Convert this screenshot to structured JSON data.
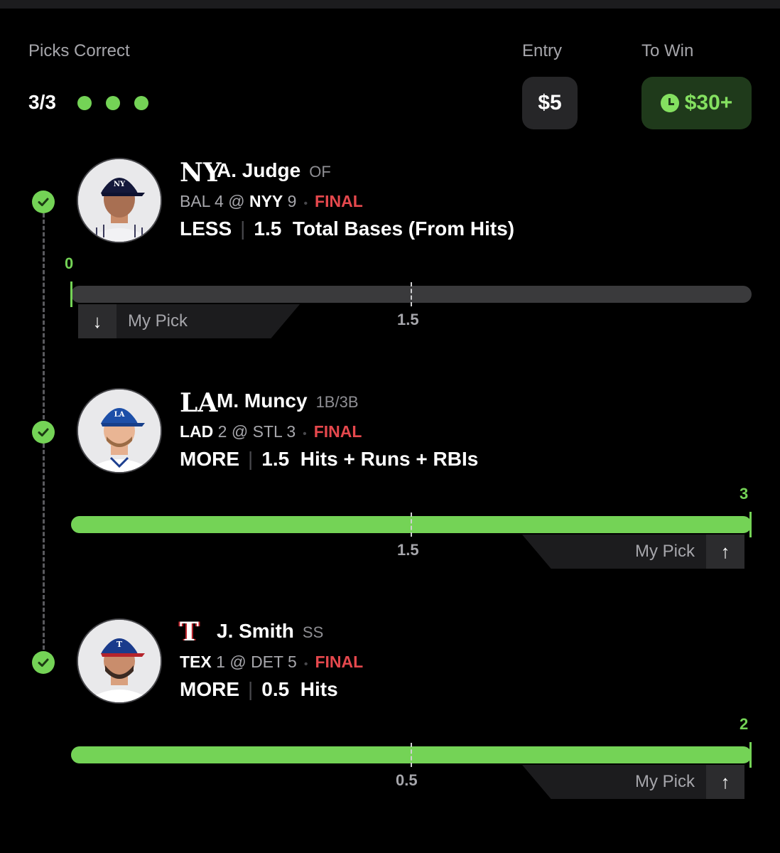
{
  "header": {
    "picks_label": "Picks Correct",
    "picks_score": "3/3",
    "entry_label": "Entry",
    "entry_value": "$5",
    "towin_label": "To Win",
    "towin_value": "$30+"
  },
  "colors": {
    "accent": "#74d356",
    "final": "#e5484d",
    "background": "#000000"
  },
  "picks": [
    {
      "team_logo": "NY",
      "player": "A. Judge",
      "position": "OF",
      "away": "BAL",
      "away_score": "4",
      "at": "@",
      "home": "NYY",
      "home_score": "9",
      "status": "FINAL",
      "direction": "LESS",
      "line": "1.5",
      "stat": "Total Bases (From Hits)",
      "result": "0",
      "line_label": "1.5",
      "pick_label": "My Pick",
      "arrow": "↓",
      "progress": 0
    },
    {
      "team_logo": "LA",
      "player": "M. Muncy",
      "position": "1B/3B",
      "away": "LAD",
      "away_score": "2",
      "at": "@",
      "home": "STL",
      "home_score": "3",
      "status": "FINAL",
      "direction": "MORE",
      "line": "1.5",
      "stat": "Hits + Runs + RBIs",
      "result": "3",
      "line_label": "1.5",
      "pick_label": "My Pick",
      "arrow": "↑",
      "progress": 1
    },
    {
      "team_logo": "T",
      "player": "J. Smith",
      "position": "SS",
      "away": "TEX",
      "away_score": "1",
      "at": "@",
      "home": "DET",
      "home_score": "5",
      "status": "FINAL",
      "direction": "MORE",
      "line": "0.5",
      "stat": "Hits",
      "result": "2",
      "line_label": "0.5",
      "pick_label": "My Pick",
      "arrow": "↑",
      "progress": 1
    }
  ]
}
